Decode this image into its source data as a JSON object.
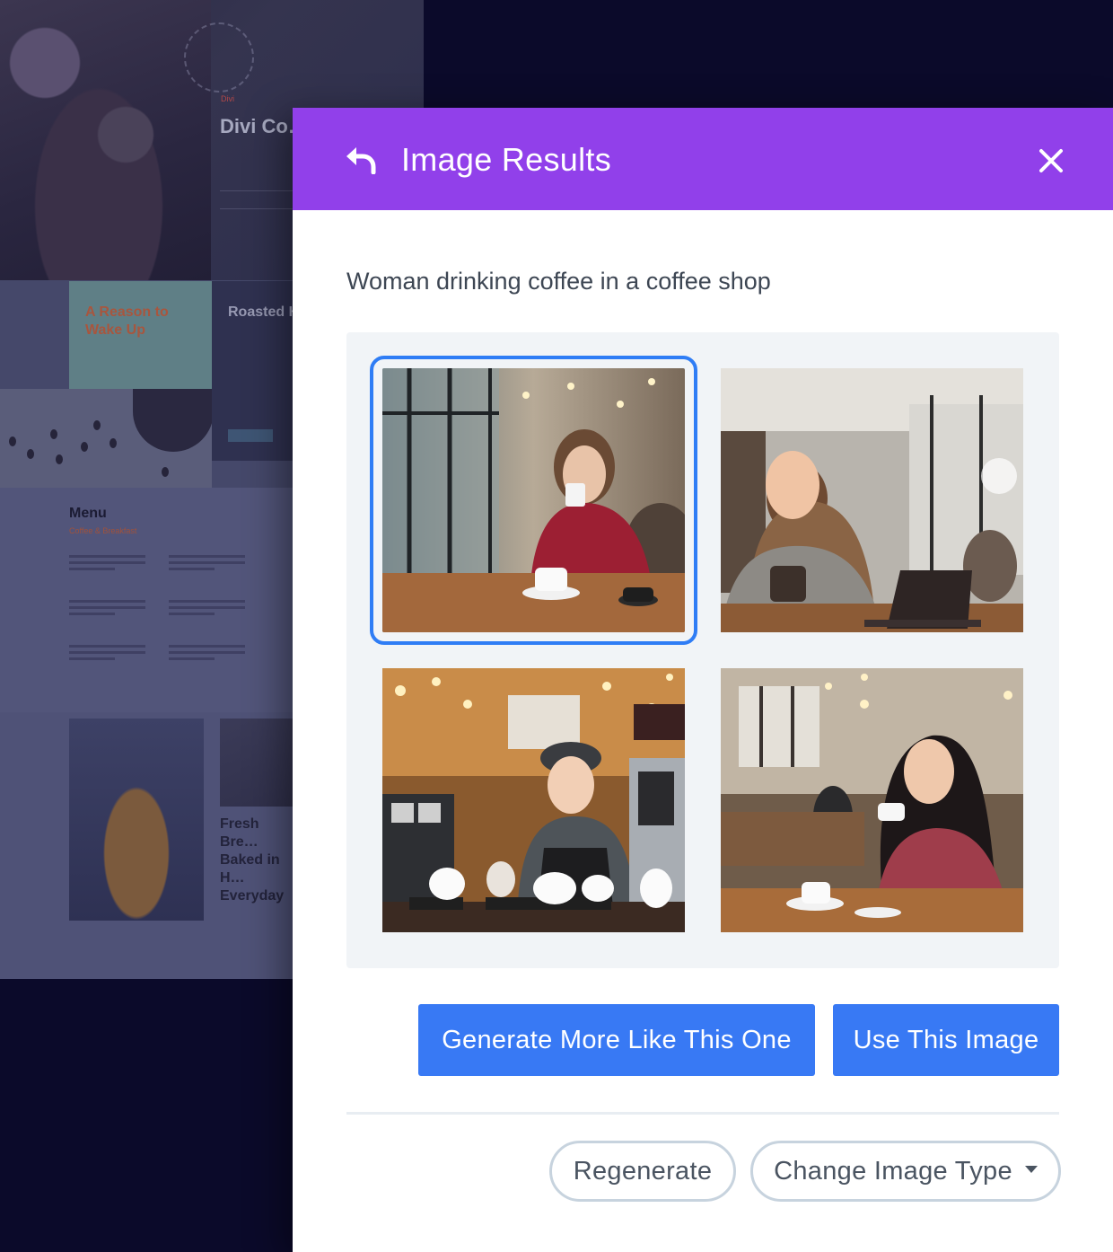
{
  "background_site": {
    "hero_label": "Divi",
    "hero_title": "Divi Co… Shop",
    "section_heading_1": "A Reason to Wake Up",
    "section_heading_2": "Roasted House",
    "menu_title": "Menu",
    "menu_subtitle": "Coffee & Breakfast",
    "bread_heading": "Fresh Bre… Baked in H… Everyday"
  },
  "modal": {
    "title": "Image Results",
    "prompt": "Woman drinking coffee in a coffee shop",
    "images": [
      {
        "alt": "Woman in red sweater holding coffee cup in cafe",
        "selected": true
      },
      {
        "alt": "Woman in grey sweater with mug and laptop",
        "selected": false
      },
      {
        "alt": "Barista in beret pouring coffee",
        "selected": false
      },
      {
        "alt": "Woman in plaid shirt holding coffee cup",
        "selected": false
      }
    ],
    "actions": {
      "generate_more": "Generate More Like This One",
      "use_image": "Use This Image",
      "regenerate": "Regenerate",
      "change_type": "Change Image Type"
    },
    "colors": {
      "header": "#9140ea",
      "primary_button": "#3879f4",
      "selection_outline": "#2f7df5"
    },
    "icons": {
      "back": "undo-arrow-icon",
      "close": "close-icon",
      "dropdown": "caret-down-icon"
    }
  }
}
